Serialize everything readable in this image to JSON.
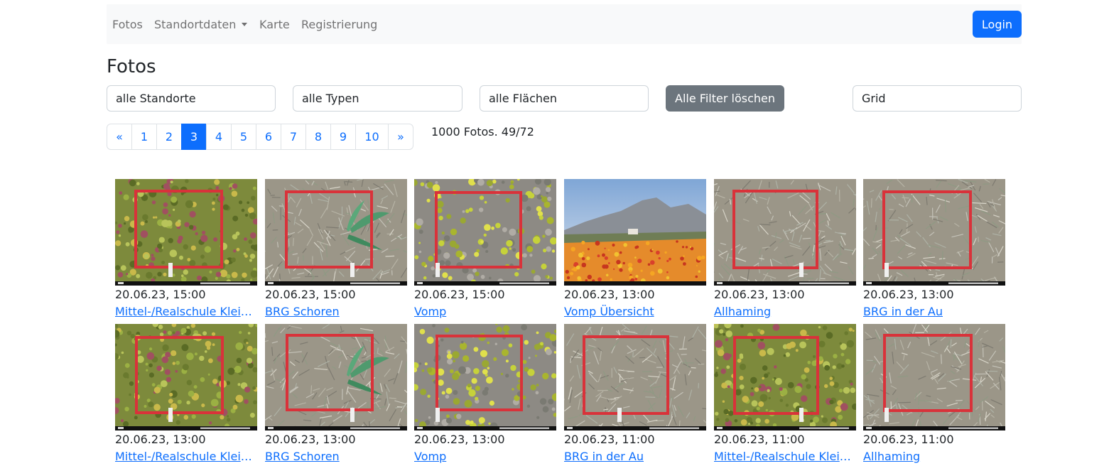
{
  "nav": {
    "fotos": "Fotos",
    "standortdaten": "Standortdaten",
    "karte": "Karte",
    "registrierung": "Registrierung",
    "login": "Login"
  },
  "page_title": "Fotos",
  "filters": {
    "standorte": "alle Standorte",
    "typen": "alle Typen",
    "flaechen": "alle Flächen",
    "clear": "Alle Filter löschen",
    "view": "Grid"
  },
  "pagination": {
    "prev": "«",
    "pages": [
      "1",
      "2",
      "3",
      "4",
      "5",
      "6",
      "7",
      "8",
      "9",
      "10"
    ],
    "active": "3",
    "next": "»"
  },
  "count_text": "1000 Fotos. 49/72",
  "photos": [
    {
      "date": "20.06.23, 15:00",
      "location": "Mittel-/Realschule Kleinsöding",
      "kind": "green"
    },
    {
      "date": "20.06.23, 15:00",
      "location": "BRG Schoren",
      "kind": "grass-plant"
    },
    {
      "date": "20.06.23, 15:00",
      "location": "Vomp",
      "kind": "sedum"
    },
    {
      "date": "20.06.23, 13:00",
      "location": "Vomp Übersicht",
      "kind": "landscape"
    },
    {
      "date": "20.06.23, 13:00",
      "location": "Allhaming",
      "kind": "grass"
    },
    {
      "date": "20.06.23, 13:00",
      "location": "BRG in der Au",
      "kind": "grass"
    },
    {
      "date": "20.06.23, 13:00",
      "location": "Mittel-/Realschule Kleinsöding",
      "kind": "green"
    },
    {
      "date": "20.06.23, 13:00",
      "location": "BRG Schoren",
      "kind": "grass-plant"
    },
    {
      "date": "20.06.23, 13:00",
      "location": "Vomp",
      "kind": "sedum"
    },
    {
      "date": "20.06.23, 11:00",
      "location": "BRG in der Au",
      "kind": "grass"
    },
    {
      "date": "20.06.23, 11:00",
      "location": "Mittel-/Realschule Kleinsöding",
      "kind": "green"
    },
    {
      "date": "20.06.23, 11:00",
      "location": "Allhaming",
      "kind": "grass"
    }
  ],
  "colors": {
    "primary": "#0d6efd",
    "secondary": "#6c757d",
    "navbar_bg": "#f8f9fa",
    "frame_red": "#d9323a"
  }
}
